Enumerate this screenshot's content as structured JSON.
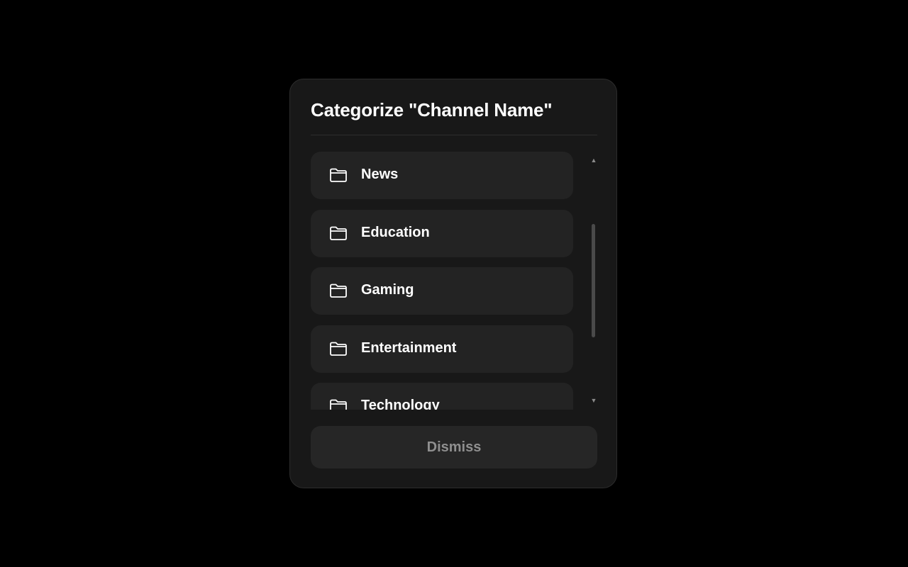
{
  "dialog": {
    "title": "Categorize \"Channel Name\"",
    "categories": [
      {
        "label": "News",
        "icon": "folder-icon"
      },
      {
        "label": "Education",
        "icon": "folder-icon"
      },
      {
        "label": "Gaming",
        "icon": "folder-icon"
      },
      {
        "label": "Entertainment",
        "icon": "folder-icon"
      },
      {
        "label": "Technology",
        "icon": "folder-icon"
      }
    ],
    "scroll_up_glyph": "▲",
    "scroll_down_glyph": "▼",
    "dismiss_label": "Dismiss"
  },
  "colors": {
    "background": "#000000",
    "dialog_background": "#181818",
    "item_background": "#232323",
    "text_primary": "#ffffff",
    "text_muted": "#8f8f8f"
  }
}
